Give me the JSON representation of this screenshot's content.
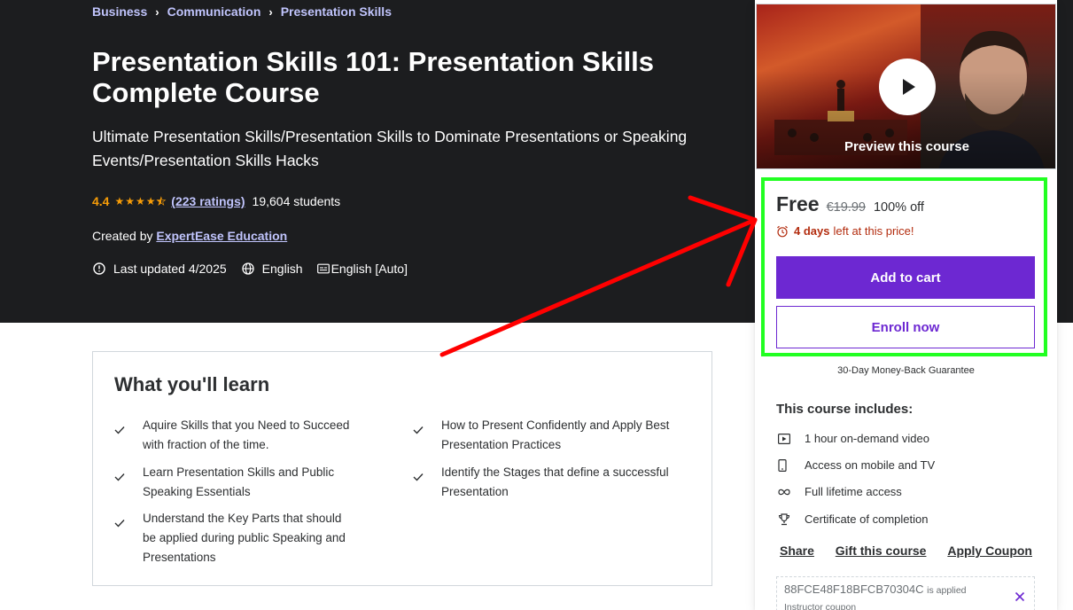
{
  "breadcrumb": [
    "Business",
    "Communication",
    "Presentation Skills"
  ],
  "breadcrumb_separator": "›",
  "course": {
    "title": "Presentation Skills 101: Presentation Skills Complete Course",
    "subtitle": "Ultimate Presentation Skills/Presentation Skills to Dominate Presentations or Speaking Events/Presentation Skills Hacks",
    "rating": "4.4",
    "stars_filled": 4.5,
    "ratings_count": "(223 ratings)",
    "students": "19,604 students",
    "created_by_label": "Created by",
    "instructor": "ExpertEase Education",
    "last_updated": "Last updated 4/2025",
    "language": "English",
    "captions": "English [Auto]"
  },
  "learn": {
    "title": "What you'll learn",
    "items": [
      "Aquire Skills that you Need to Succeed with fraction of the time.",
      "How to Present Confidently and Apply Best Presentation Practices",
      "Learn Presentation Skills and Public Speaking Essentials",
      "Identify the Stages that define a successful Presentation",
      "Understand the Key Parts that should be applied during public Speaking and Presentations"
    ]
  },
  "sidebar": {
    "preview_label": "Preview this course",
    "price": "Free",
    "original_price": "€19.99",
    "discount": "100% off",
    "timer_days": "4 days",
    "timer_text": "left at this price!",
    "add_to_cart": "Add to cart",
    "enroll_now": "Enroll now",
    "guarantee": "30-Day Money-Back Guarantee",
    "includes_title": "This course includes:",
    "includes": [
      {
        "icon": "video-icon",
        "text": "1 hour on-demand video"
      },
      {
        "icon": "mobile-icon",
        "text": "Access on mobile and TV"
      },
      {
        "icon": "infinity-icon",
        "text": "Full lifetime access"
      },
      {
        "icon": "trophy-icon",
        "text": "Certificate of completion"
      }
    ],
    "links": {
      "share": "Share",
      "gift": "Gift this course",
      "coupon": "Apply Coupon"
    },
    "coupon_code": "88FCE48F18BFCB70304C",
    "coupon_applied": "is applied",
    "coupon_sub": "Instructor coupon"
  },
  "colors": {
    "hero_bg": "#1c1d1f",
    "link_purple": "#c0c4fc",
    "star": "#f69c08",
    "brand_purple": "#6d28d2",
    "timer_red": "#b32d0f",
    "annotation_green": "#22ff22",
    "annotation_red": "#ff0000"
  }
}
